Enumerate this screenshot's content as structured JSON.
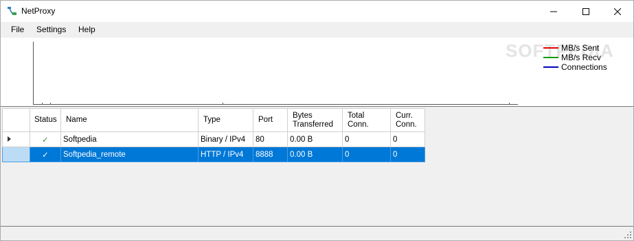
{
  "window": {
    "title": "NetProxy"
  },
  "menu": {
    "items": [
      "File",
      "Settings",
      "Help"
    ]
  },
  "graph": {
    "legend": [
      {
        "label": "MB/s Sent",
        "color": "#e00000"
      },
      {
        "label": "MB/s Recv",
        "color": "#00a000"
      },
      {
        "label": "Connections",
        "color": "#0000c0"
      }
    ],
    "watermark": "SOFTPEDIA"
  },
  "grid": {
    "columns": {
      "status": "Status",
      "name": "Name",
      "type": "Type",
      "port": "Port",
      "bytes_line1": "Bytes",
      "bytes_line2": "Transferred",
      "total_line1": "Total",
      "total_line2": "Conn.",
      "curr_line1": "Curr.",
      "curr_line2": "Conn."
    },
    "rows": [
      {
        "status": "✓",
        "name": "Softpedia",
        "type": "Binary / IPv4",
        "port": "80",
        "bytes": "0.00 B",
        "total": "0",
        "curr": "0"
      },
      {
        "status": "✓",
        "name": "Softpedia_remote",
        "type": "HTTP / IPv4",
        "port": "8888",
        "bytes": "0.00 B",
        "total": "0",
        "curr": "0"
      }
    ]
  }
}
